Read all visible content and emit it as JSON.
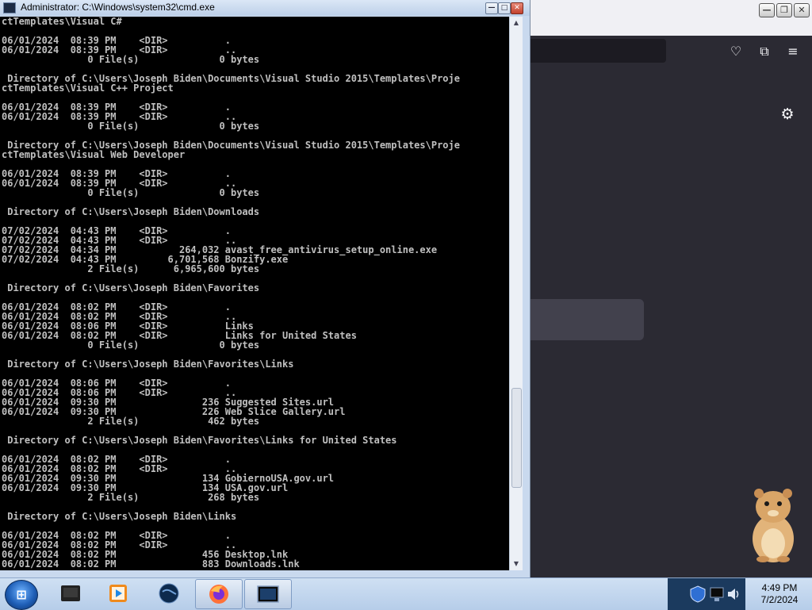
{
  "cmd": {
    "title": "Administrator: C:\\Windows\\system32\\cmd.exe",
    "lines": [
      "ctTemplates\\Visual C#",
      "",
      "06/01/2024  08:39 PM    <DIR>          .",
      "06/01/2024  08:39 PM    <DIR>          ..",
      "               0 File(s)              0 bytes",
      "",
      " Directory of C:\\Users\\Joseph Biden\\Documents\\Visual Studio 2015\\Templates\\Proje",
      "ctTemplates\\Visual C++ Project",
      "",
      "06/01/2024  08:39 PM    <DIR>          .",
      "06/01/2024  08:39 PM    <DIR>          ..",
      "               0 File(s)              0 bytes",
      "",
      " Directory of C:\\Users\\Joseph Biden\\Documents\\Visual Studio 2015\\Templates\\Proje",
      "ctTemplates\\Visual Web Developer",
      "",
      "06/01/2024  08:39 PM    <DIR>          .",
      "06/01/2024  08:39 PM    <DIR>          ..",
      "               0 File(s)              0 bytes",
      "",
      " Directory of C:\\Users\\Joseph Biden\\Downloads",
      "",
      "07/02/2024  04:43 PM    <DIR>          .",
      "07/02/2024  04:43 PM    <DIR>          ..",
      "07/02/2024  04:34 PM           264,032 avast_free_antivirus_setup_online.exe",
      "07/02/2024  04:43 PM         6,701,568 Bonzify.exe",
      "               2 File(s)      6,965,600 bytes",
      "",
      " Directory of C:\\Users\\Joseph Biden\\Favorites",
      "",
      "06/01/2024  08:02 PM    <DIR>          .",
      "06/01/2024  08:02 PM    <DIR>          ..",
      "06/01/2024  08:06 PM    <DIR>          Links",
      "06/01/2024  08:02 PM    <DIR>          Links for United States",
      "               0 File(s)              0 bytes",
      "",
      " Directory of C:\\Users\\Joseph Biden\\Favorites\\Links",
      "",
      "06/01/2024  08:06 PM    <DIR>          .",
      "06/01/2024  08:06 PM    <DIR>          ..",
      "06/01/2024  09:30 PM               236 Suggested Sites.url",
      "06/01/2024  09:30 PM               226 Web Slice Gallery.url",
      "               2 File(s)            462 bytes",
      "",
      " Directory of C:\\Users\\Joseph Biden\\Favorites\\Links for United States",
      "",
      "06/01/2024  08:02 PM    <DIR>          .",
      "06/01/2024  08:02 PM    <DIR>          ..",
      "06/01/2024  09:30 PM               134 GobiernoUSA.gov.url",
      "06/01/2024  09:30 PM               134 USA.gov.url",
      "               2 File(s)            268 bytes",
      "",
      " Directory of C:\\Users\\Joseph Biden\\Links",
      "",
      "06/01/2024  08:02 PM    <DIR>          .",
      "06/01/2024  08:02 PM    <DIR>          ..",
      "06/01/2024  08:02 PM               456 Desktop.lnk",
      "06/01/2024  08:02 PM               883 Downloads.lnk"
    ],
    "controls": {
      "minimize": "—",
      "maximize": "□",
      "close": "✕"
    },
    "scroll_up": "▲",
    "scroll_down": "▼"
  },
  "browser": {
    "controls": {
      "minimize": "—",
      "restore": "❐",
      "close": "✕"
    },
    "toolbar_icons": [
      "pocket-icon",
      "extensions-icon",
      "menu-icon"
    ],
    "toolbar_glyphs": {
      "pocket": "♡",
      "extensions": "⧉",
      "menu": "≡"
    },
    "gear_glyph": "⚙"
  },
  "taskbar": {
    "start_glyph": "⊞",
    "apps": [
      {
        "name": "desktop-app-icon"
      },
      {
        "name": "media-player-icon"
      },
      {
        "name": "globe-app-icon"
      },
      {
        "name": "firefox-icon"
      },
      {
        "name": "cmd-icon"
      }
    ],
    "clock": {
      "time": "4:49 PM",
      "date": "7/2/2024"
    }
  },
  "colors": {
    "console_bg": "#000000",
    "console_fg": "#c0c0c0",
    "browser_bg": "#2b2a33",
    "taskbar": "#c4d7ee"
  }
}
